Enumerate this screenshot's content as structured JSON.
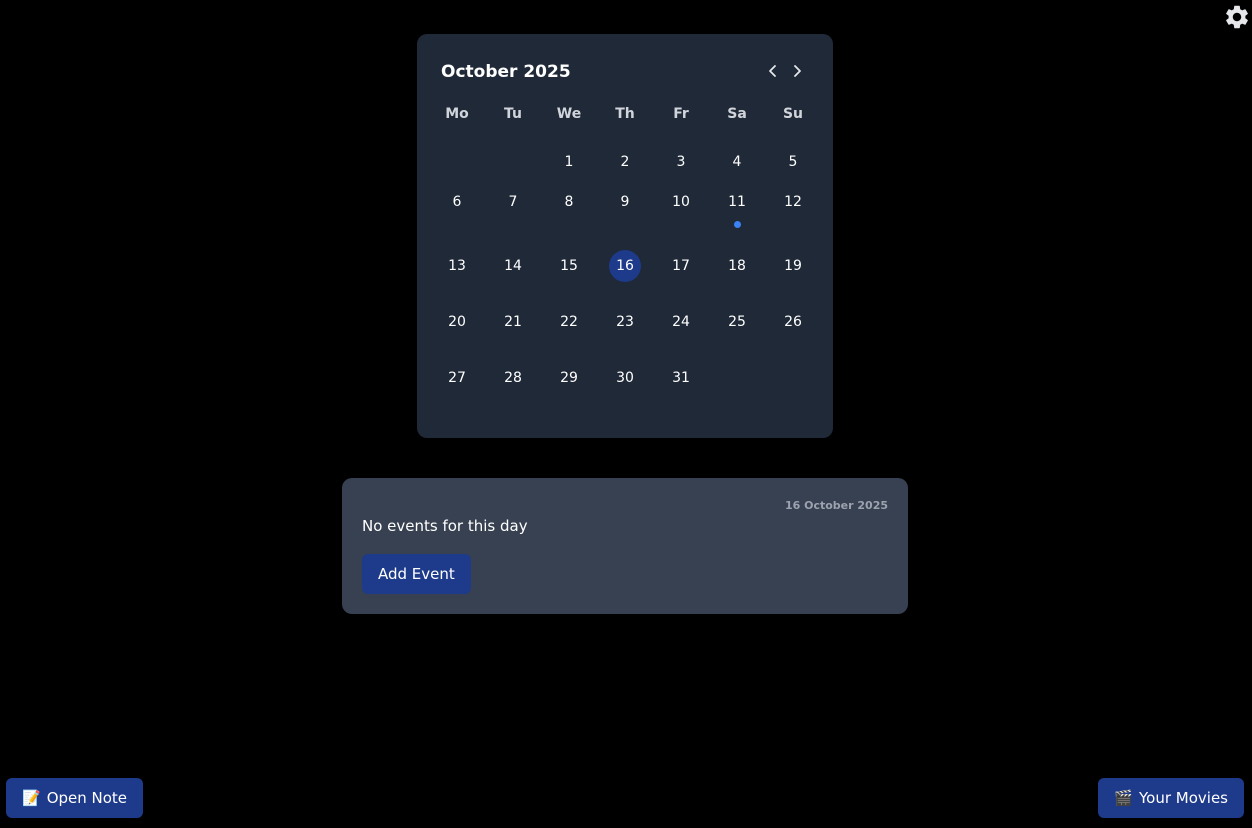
{
  "settings": {
    "icon": "gear-icon"
  },
  "calendar": {
    "month_title": "October 2025",
    "prev_icon": "chevron-left-icon",
    "next_icon": "chevron-right-icon",
    "weekdays": [
      "Mo",
      "Tu",
      "We",
      "Th",
      "Fr",
      "Sa",
      "Su"
    ],
    "leading_blanks": 2,
    "days": [
      "1",
      "2",
      "3",
      "4",
      "5",
      "6",
      "7",
      "8",
      "9",
      "10",
      "11",
      "12",
      "13",
      "14",
      "15",
      "16",
      "17",
      "18",
      "19",
      "20",
      "21",
      "22",
      "23",
      "24",
      "25",
      "26",
      "27",
      "28",
      "29",
      "30",
      "31"
    ],
    "selected_day": "16",
    "days_with_events": [
      "11"
    ],
    "colors": {
      "card_bg": "#1f2937",
      "selected_bg": "#1e3a8a",
      "event_dot": "#3b82f6"
    }
  },
  "events_panel": {
    "date_label": "16 October 2025",
    "empty_message": "No events for this day",
    "add_button": "Add Event"
  },
  "bottom_bar": {
    "open_note": {
      "icon": "note-icon",
      "label": "Open Note"
    },
    "your_movies": {
      "icon": "clapperboard-icon",
      "label": "Your Movies"
    }
  }
}
